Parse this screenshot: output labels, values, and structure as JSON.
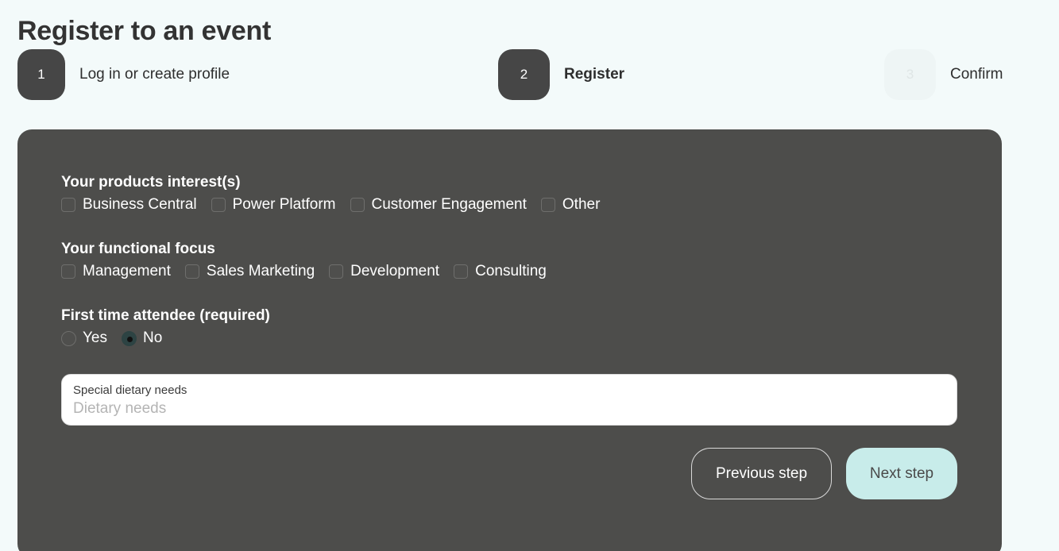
{
  "page": {
    "title": "Register to an event"
  },
  "stepper": {
    "steps": [
      {
        "number": "1",
        "label": "Log in or create profile",
        "state": "done"
      },
      {
        "number": "2",
        "label": "Register",
        "state": "current"
      },
      {
        "number": "3",
        "label": "Confirm",
        "state": "upcoming"
      }
    ]
  },
  "form": {
    "products": {
      "title": "Your products interest(s)",
      "options": [
        {
          "label": "Business Central",
          "checked": false
        },
        {
          "label": "Power Platform",
          "checked": false
        },
        {
          "label": "Customer Engagement",
          "checked": false
        },
        {
          "label": "Other",
          "checked": false
        }
      ]
    },
    "focus": {
      "title": "Your functional focus",
      "options": [
        {
          "label": "Management",
          "checked": false
        },
        {
          "label": "Sales Marketing",
          "checked": false
        },
        {
          "label": "Development",
          "checked": false
        },
        {
          "label": "Consulting",
          "checked": false
        }
      ]
    },
    "first_time": {
      "title": "First time attendee (required)",
      "options": [
        {
          "label": "Yes",
          "selected": false
        },
        {
          "label": "No",
          "selected": true
        }
      ]
    },
    "dietary": {
      "label": "Special dietary needs",
      "placeholder": "Dietary needs",
      "value": ""
    },
    "buttons": {
      "previous": "Previous step",
      "next": "Next step"
    }
  },
  "colors": {
    "background": "#f3fafa",
    "card": "#4d4d4b",
    "step_active": "#464646",
    "step_inactive": "#eef5f5",
    "next_button": "#c8ecea"
  }
}
